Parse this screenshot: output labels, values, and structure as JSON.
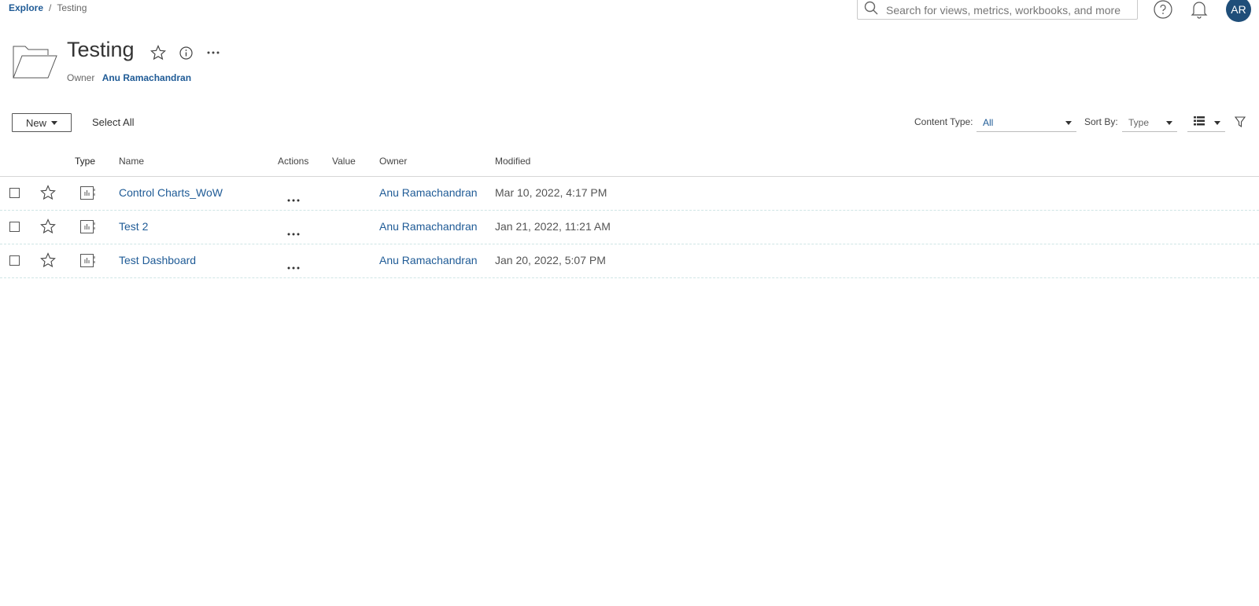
{
  "breadcrumb": {
    "root": "Explore",
    "separator": "/",
    "current": "Testing"
  },
  "search": {
    "placeholder": "Search for views, metrics, workbooks, and more"
  },
  "user": {
    "initials": "AR"
  },
  "header": {
    "title": "Testing",
    "owner_label": "Owner",
    "owner_name": "Anu Ramachandran"
  },
  "toolbar": {
    "new_label": "New",
    "select_all_label": "Select All",
    "content_type_label": "Content Type:",
    "content_type_value": "All",
    "sort_by_label": "Sort By:",
    "sort_by_value": "Type"
  },
  "table": {
    "columns": [
      "Type",
      "Name",
      "Actions",
      "Value",
      "Owner",
      "Modified"
    ],
    "rows": [
      {
        "name": "Control Charts_WoW",
        "owner": "Anu Ramachandran",
        "modified": "Mar 10, 2022, 4:17 PM"
      },
      {
        "name": "Test 2",
        "owner": "Anu Ramachandran",
        "modified": "Jan 21, 2022, 11:21 AM"
      },
      {
        "name": "Test Dashboard",
        "owner": "Anu Ramachandran",
        "modified": "Jan 20, 2022, 5:07 PM"
      }
    ]
  },
  "icons": {
    "search": "search-icon",
    "help": "help-icon",
    "bell": "notifications-icon",
    "folder": "folder-icon",
    "star": "star-icon",
    "info": "info-icon",
    "more": "more-icon",
    "list_view": "list-view-icon",
    "filter": "filter-icon",
    "workbook": "workbook-icon"
  },
  "colors": {
    "link": "#1f5b96",
    "avatar_bg": "#1f4e79"
  }
}
